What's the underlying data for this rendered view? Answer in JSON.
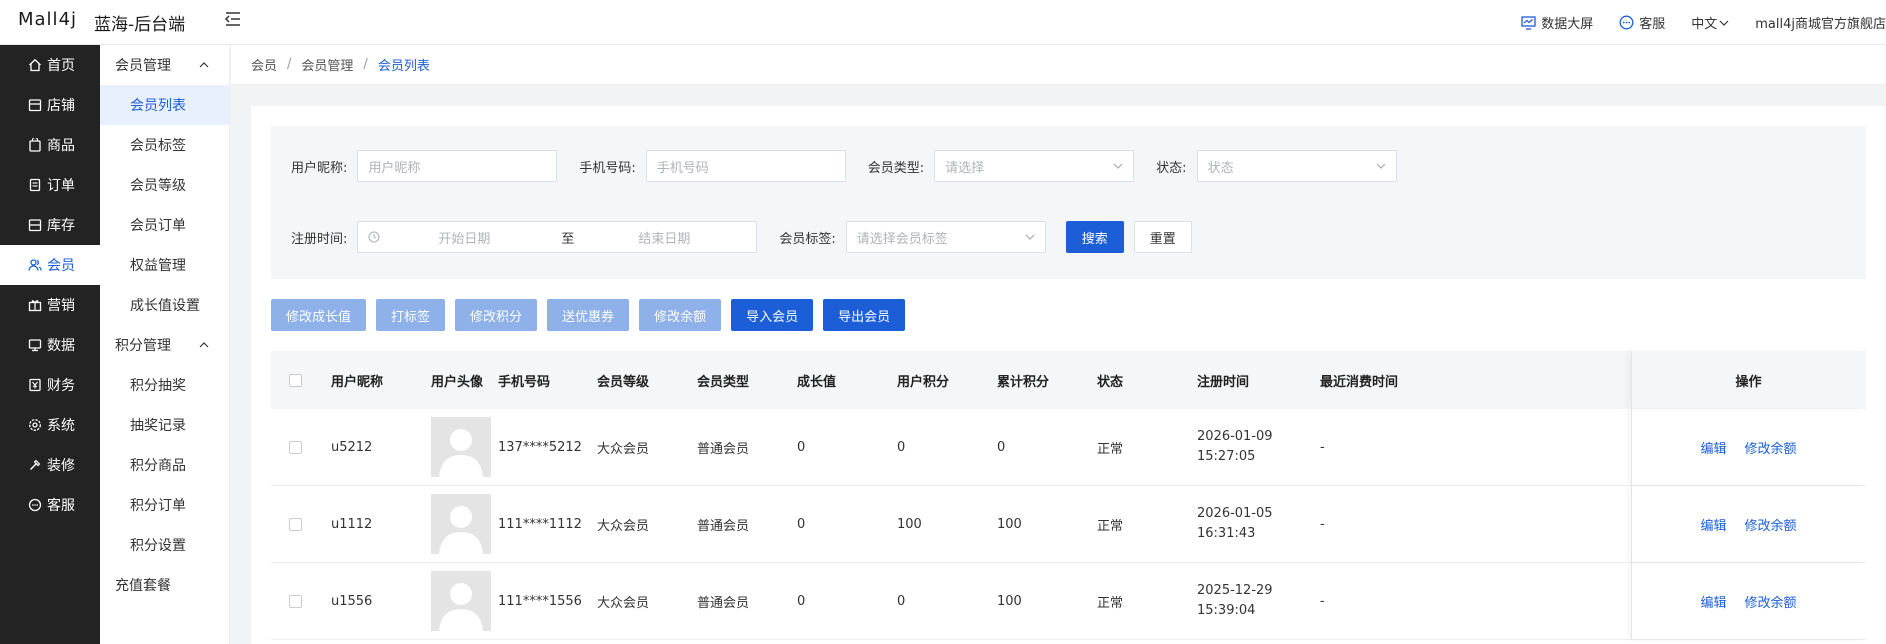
{
  "header": {
    "logo": "Mall4j",
    "app_name": "蓝海-后台端",
    "data_screen": "数据大屏",
    "customer_service": "客服",
    "language": "中文",
    "store_name": "mall4j商城官方旗舰店"
  },
  "nav": [
    {
      "label": "首页",
      "icon": "home-icon"
    },
    {
      "label": "店铺",
      "icon": "shop-icon"
    },
    {
      "label": "商品",
      "icon": "goods-icon"
    },
    {
      "label": "订单",
      "icon": "order-icon"
    },
    {
      "label": "库存",
      "icon": "stock-icon"
    },
    {
      "label": "会员",
      "icon": "member-icon"
    },
    {
      "label": "营销",
      "icon": "marketing-icon"
    },
    {
      "label": "数据",
      "icon": "data-icon"
    },
    {
      "label": "财务",
      "icon": "finance-icon"
    },
    {
      "label": "系统",
      "icon": "system-icon"
    },
    {
      "label": "装修",
      "icon": "decorate-icon"
    },
    {
      "label": "客服",
      "icon": "chat-icon"
    }
  ],
  "subnav": {
    "group1": "会员管理",
    "items1": [
      "会员列表",
      "会员标签",
      "会员等级",
      "会员订单",
      "权益管理",
      "成长值设置"
    ],
    "group2": "积分管理",
    "items2": [
      "积分抽奖",
      "抽奖记录",
      "积分商品",
      "积分订单",
      "积分设置"
    ],
    "item3": "充值套餐"
  },
  "breadcrumb": [
    "会员",
    "会员管理",
    "会员列表"
  ],
  "filters": {
    "nickname_label": "用户昵称:",
    "nickname_placeholder": "用户昵称",
    "phone_label": "手机号码:",
    "phone_placeholder": "手机号码",
    "member_type_label": "会员类型:",
    "member_type_placeholder": "请选择",
    "status_label": "状态:",
    "status_placeholder": "状态",
    "reg_time_label": "注册时间:",
    "start_date": "开始日期",
    "to": "至",
    "end_date": "结束日期",
    "tag_label": "会员标签:",
    "tag_placeholder": "请选择会员标签",
    "search": "搜索",
    "reset": "重置"
  },
  "actions": [
    "修改成长值",
    "打标签",
    "修改积分",
    "送优惠券",
    "修改余额",
    "导入会员",
    "导出会员"
  ],
  "table": {
    "columns": [
      "用户昵称",
      "用户头像",
      "手机号码",
      "会员等级",
      "会员类型",
      "成长值",
      "用户积分",
      "累计积分",
      "状态",
      "注册时间",
      "最近消费时间",
      "操作"
    ],
    "rows": [
      {
        "nickname": "u5212",
        "phone": "137****5212",
        "level": "大众会员",
        "type": "普通会员",
        "growth": "0",
        "points": "0",
        "total_points": "0",
        "status": "正常",
        "reg_date": "2026-01-09",
        "reg_time": "15:27:05",
        "last": "-"
      },
      {
        "nickname": "u1112",
        "phone": "111****1112",
        "level": "大众会员",
        "type": "普通会员",
        "growth": "0",
        "points": "100",
        "total_points": "100",
        "status": "正常",
        "reg_date": "2026-01-05",
        "reg_time": "16:31:43",
        "last": "-"
      },
      {
        "nickname": "u1556",
        "phone": "111****1556",
        "level": "大众会员",
        "type": "普通会员",
        "growth": "0",
        "points": "0",
        "total_points": "100",
        "status": "正常",
        "reg_date": "2025-12-29",
        "reg_time": "15:39:04",
        "last": "-"
      }
    ],
    "op_edit": "编辑",
    "op_balance": "修改余额"
  }
}
